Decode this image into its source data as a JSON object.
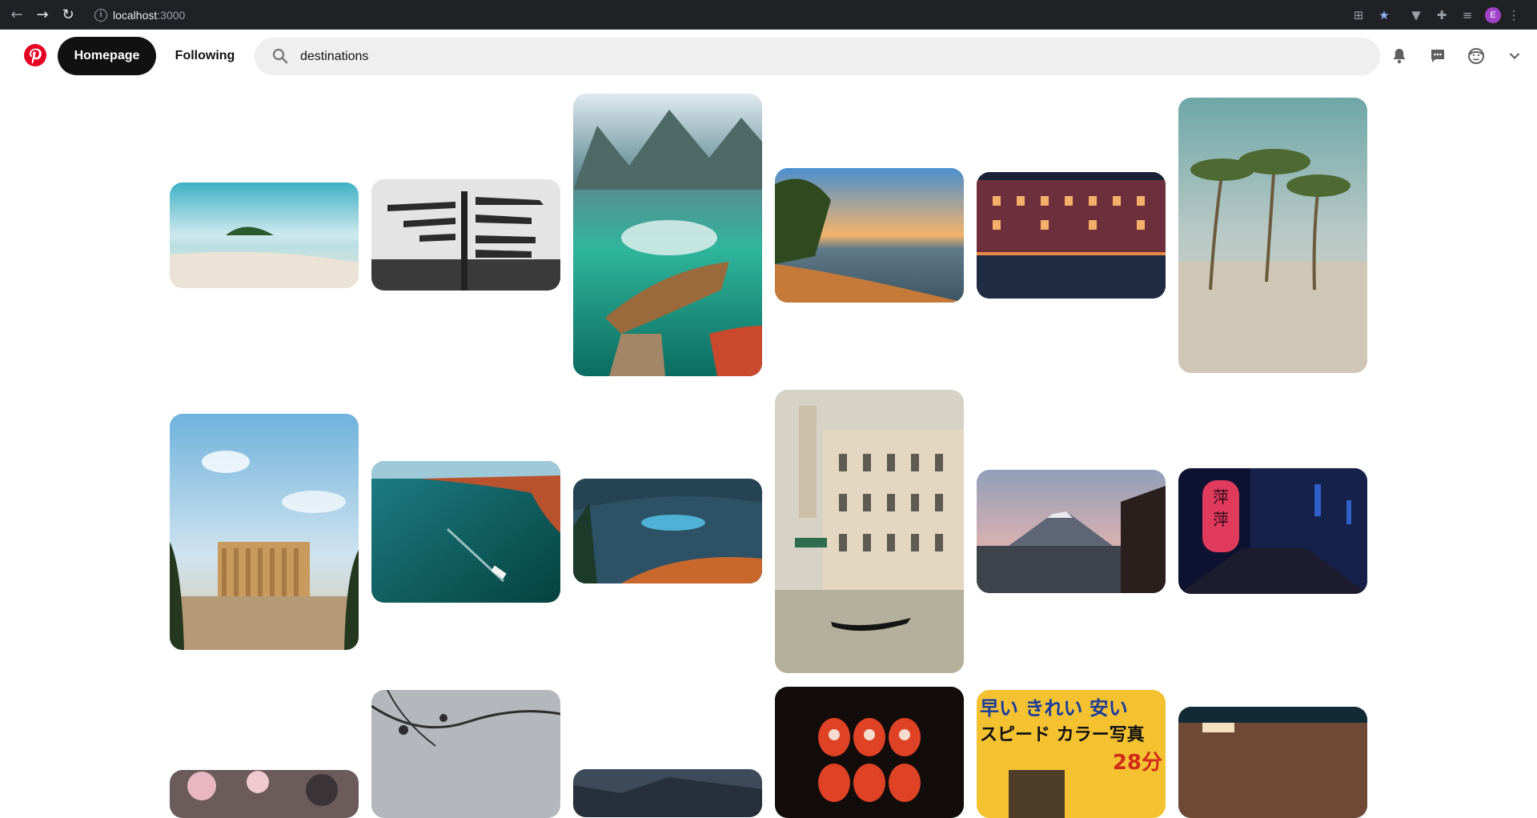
{
  "browser": {
    "url_host": "localhost",
    "url_port": ":3000",
    "profile_initial": "E"
  },
  "header": {
    "home_label": "Homepage",
    "following_label": "Following",
    "search_value": "destinations"
  },
  "colors": {
    "brand": "#e60023",
    "active_pill": "#111111",
    "search_bg": "#efefef"
  },
  "icons": [
    "pinterest-logo-icon",
    "search-icon",
    "bell-icon",
    "messages-icon",
    "profile-icon",
    "chevron-down-icon"
  ],
  "pins": [
    {
      "name": "pin-island-beach",
      "theme": "island"
    },
    {
      "name": "pin-signpost",
      "theme": "signpost"
    },
    {
      "name": "pin-lake-boat",
      "theme": "lakeboat"
    },
    {
      "name": "pin-sunset-beach",
      "theme": "sunsetbeach"
    },
    {
      "name": "pin-canal-town-night",
      "theme": "canalnight"
    },
    {
      "name": "pin-palm-beach",
      "theme": "palms"
    },
    {
      "name": "pin-parthenon",
      "theme": "parthenon"
    },
    {
      "name": "pin-coast-ship",
      "theme": "coastship"
    },
    {
      "name": "pin-mountain-lake",
      "theme": "mtnlake"
    },
    {
      "name": "pin-venice-gondola",
      "theme": "venice"
    },
    {
      "name": "pin-mount-fuji",
      "theme": "fuji"
    },
    {
      "name": "pin-neon-alley",
      "theme": "neon"
    },
    {
      "name": "pin-cherry-blossom",
      "theme": "blossom"
    },
    {
      "name": "pin-branches-temple",
      "theme": "branches"
    },
    {
      "name": "pin-dusk-trees",
      "theme": "dusk"
    },
    {
      "name": "pin-red-lanterns",
      "theme": "lanterns"
    },
    {
      "name": "pin-japanese-sign",
      "theme": "jpsign"
    },
    {
      "name": "pin-lantern-street",
      "theme": "lanternstreet"
    }
  ],
  "sign": {
    "line1": "早い きれい 安い",
    "line2": "スピード カラー写真",
    "line3": "28分"
  },
  "neon_sign": {
    "line1": "萍",
    "line2": "萍"
  }
}
